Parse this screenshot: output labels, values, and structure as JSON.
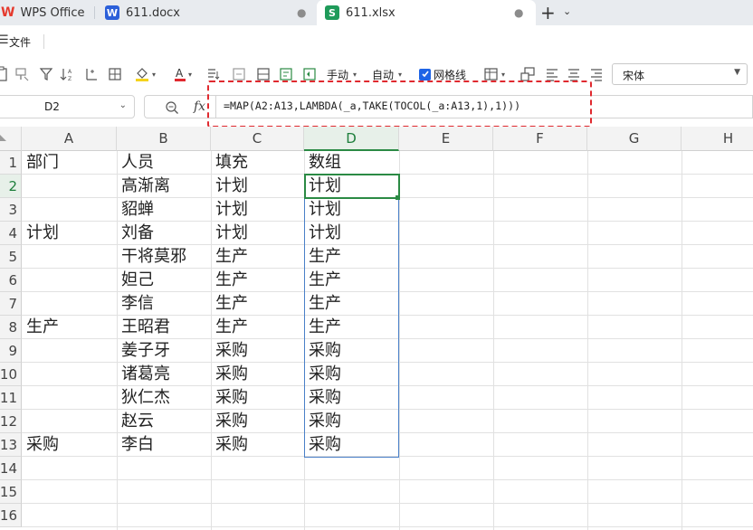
{
  "tabs": [
    {
      "label": "WPS Office",
      "icon": "wps-logo-icon"
    },
    {
      "label": "611.docx",
      "icon_text": "W",
      "icon_color": "#2b5fd9"
    },
    {
      "label": "611.xlsx",
      "icon_text": "S",
      "icon_color": "#1f9b5a"
    }
  ],
  "menu": {
    "file": "文件"
  },
  "toolbar": {
    "wrap_label": "手动",
    "autofit_label": "自动",
    "gridlines_label": "网格线",
    "font": "宋体"
  },
  "formula_bar": {
    "cell_ref": "D2",
    "fx": "fx",
    "formula": "=MAP(A2:A13,LAMBDA(_a,TAKE(TOCOL(_a:A13,1),1)))"
  },
  "columns": [
    "A",
    "B",
    "C",
    "D",
    "E",
    "F",
    "G",
    "H"
  ],
  "rows": [
    "1",
    "2",
    "3",
    "4",
    "5",
    "6",
    "7",
    "8",
    "9",
    "10",
    "11",
    "12",
    "13",
    "14",
    "15",
    "16"
  ],
  "cells": {
    "A": [
      "部门",
      "",
      "",
      "计划",
      "",
      "",
      "",
      "生产",
      "",
      "",
      "",
      "",
      "采购"
    ],
    "B": [
      "人员",
      "高渐离",
      "貂蝉",
      "刘备",
      "干将莫邪",
      "妲己",
      "李信",
      "王昭君",
      "姜子牙",
      "诸葛亮",
      "狄仁杰",
      "赵云",
      "李白"
    ],
    "C": [
      "填充",
      "计划",
      "计划",
      "计划",
      "生产",
      "生产",
      "生产",
      "生产",
      "采购",
      "采购",
      "采购",
      "采购",
      "采购"
    ],
    "D": [
      "数组",
      "计划",
      "计划",
      "计划",
      "生产",
      "生产",
      "生产",
      "生产",
      "采购",
      "采购",
      "采购",
      "采购",
      "采购"
    ]
  },
  "colors": {
    "accent_green": "#2b8a44",
    "highlight_red": "#e0292f",
    "spill_blue": "#4a80c8",
    "checkbox_blue": "#1e64e6"
  }
}
